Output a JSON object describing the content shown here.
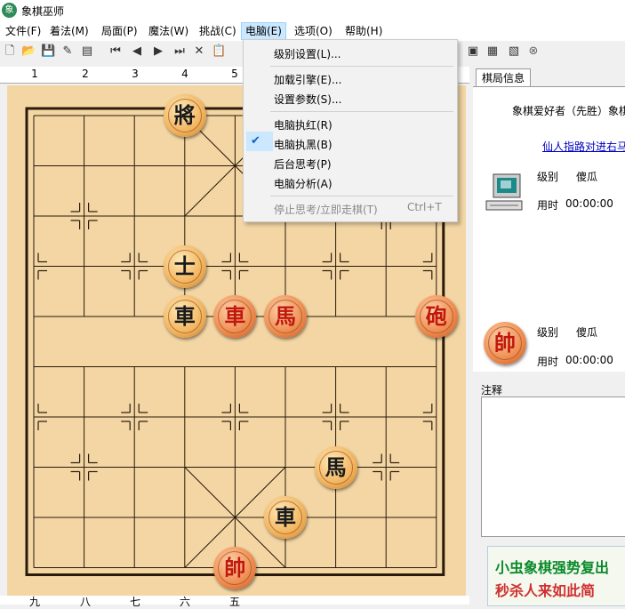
{
  "window": {
    "title": "象棋巫师",
    "icon_glyph": "象"
  },
  "menubar": [
    "文件(F)",
    "着法(M)",
    "局面(P)",
    "魔法(W)",
    "挑战(C)",
    "电脑(E)",
    "选项(O)",
    "帮助(H)"
  ],
  "computer_menu": {
    "items": [
      "级别设置(L)...",
      "加载引擎(E)...",
      "设置参数(S)...",
      "电脑执红(R)",
      "电脑执黑(B)",
      "后台思考(P)",
      "电脑分析(A)",
      "停止思考/立即走棋(T)"
    ],
    "checked_item": "电脑执黑(B)",
    "stop_shortcut": "Ctrl+T"
  },
  "ruler_top": [
    "1",
    "2",
    "3",
    "4",
    "5"
  ],
  "ruler_bottom": [
    "九",
    "八",
    "七",
    "六",
    "五"
  ],
  "board_pieces": [
    {
      "char": "將",
      "side": "black",
      "file": 4,
      "rank": 0
    },
    {
      "char": "士",
      "side": "black",
      "file": 4,
      "rank": 3
    },
    {
      "char": "車",
      "side": "black",
      "file": 4,
      "rank": 4
    },
    {
      "char": "車",
      "side": "red",
      "file": 5,
      "rank": 4
    },
    {
      "char": "馬",
      "side": "red",
      "file": 6,
      "rank": 4
    },
    {
      "char": "砲",
      "side": "red",
      "file": 9,
      "rank": 4
    },
    {
      "char": "馬",
      "side": "black",
      "file": 7,
      "rank": 7
    },
    {
      "char": "車",
      "side": "black",
      "file": 6,
      "rank": 8
    },
    {
      "char": "帥",
      "side": "red",
      "file": 5,
      "rank": 9
    }
  ],
  "info": {
    "tab": "棋局信息",
    "players": "象棋爱好者（先胜）象棋",
    "opening": "仙人指路对进右马",
    "computer_player": {
      "level_label": "级别",
      "level_value": "傻瓜",
      "time_label": "用时",
      "time_value": "00:00:00"
    },
    "red_player": {
      "piece": "帥",
      "level_label": "级别",
      "level_value": "傻瓜",
      "time_label": "用时",
      "time_value": "00:00:00"
    }
  },
  "notes_label": "注释",
  "banner": {
    "line1": "小虫象棋强势复出",
    "line2": "秒杀人来如此简"
  }
}
